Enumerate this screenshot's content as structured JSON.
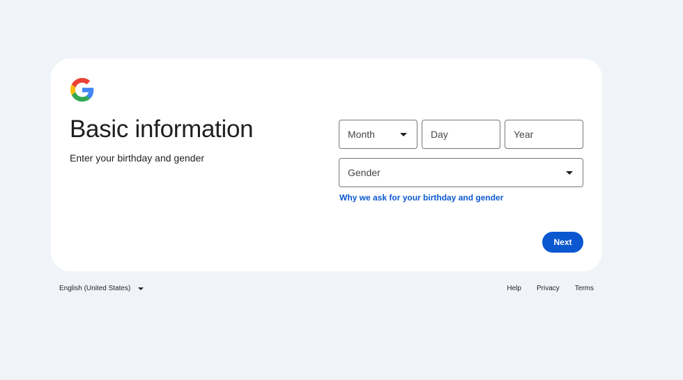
{
  "page": {
    "title": "Basic information",
    "subtitle": "Enter your birthday and gender"
  },
  "form": {
    "month_placeholder": "Month",
    "day_placeholder": "Day",
    "year_placeholder": "Year",
    "gender_placeholder": "Gender",
    "why_link": "Why we ask for your birthday and gender",
    "next_label": "Next"
  },
  "footer": {
    "language": "English (United States)",
    "links": [
      "Help",
      "Privacy",
      "Terms"
    ]
  },
  "icons": {
    "logo": "google-logo-icon",
    "caret": "caret-down-icon"
  },
  "colors": {
    "background": "#f0f4f9",
    "card": "#ffffff",
    "accent": "#0b57d0",
    "text": "#1f1f1f",
    "field_border": "#747775"
  }
}
